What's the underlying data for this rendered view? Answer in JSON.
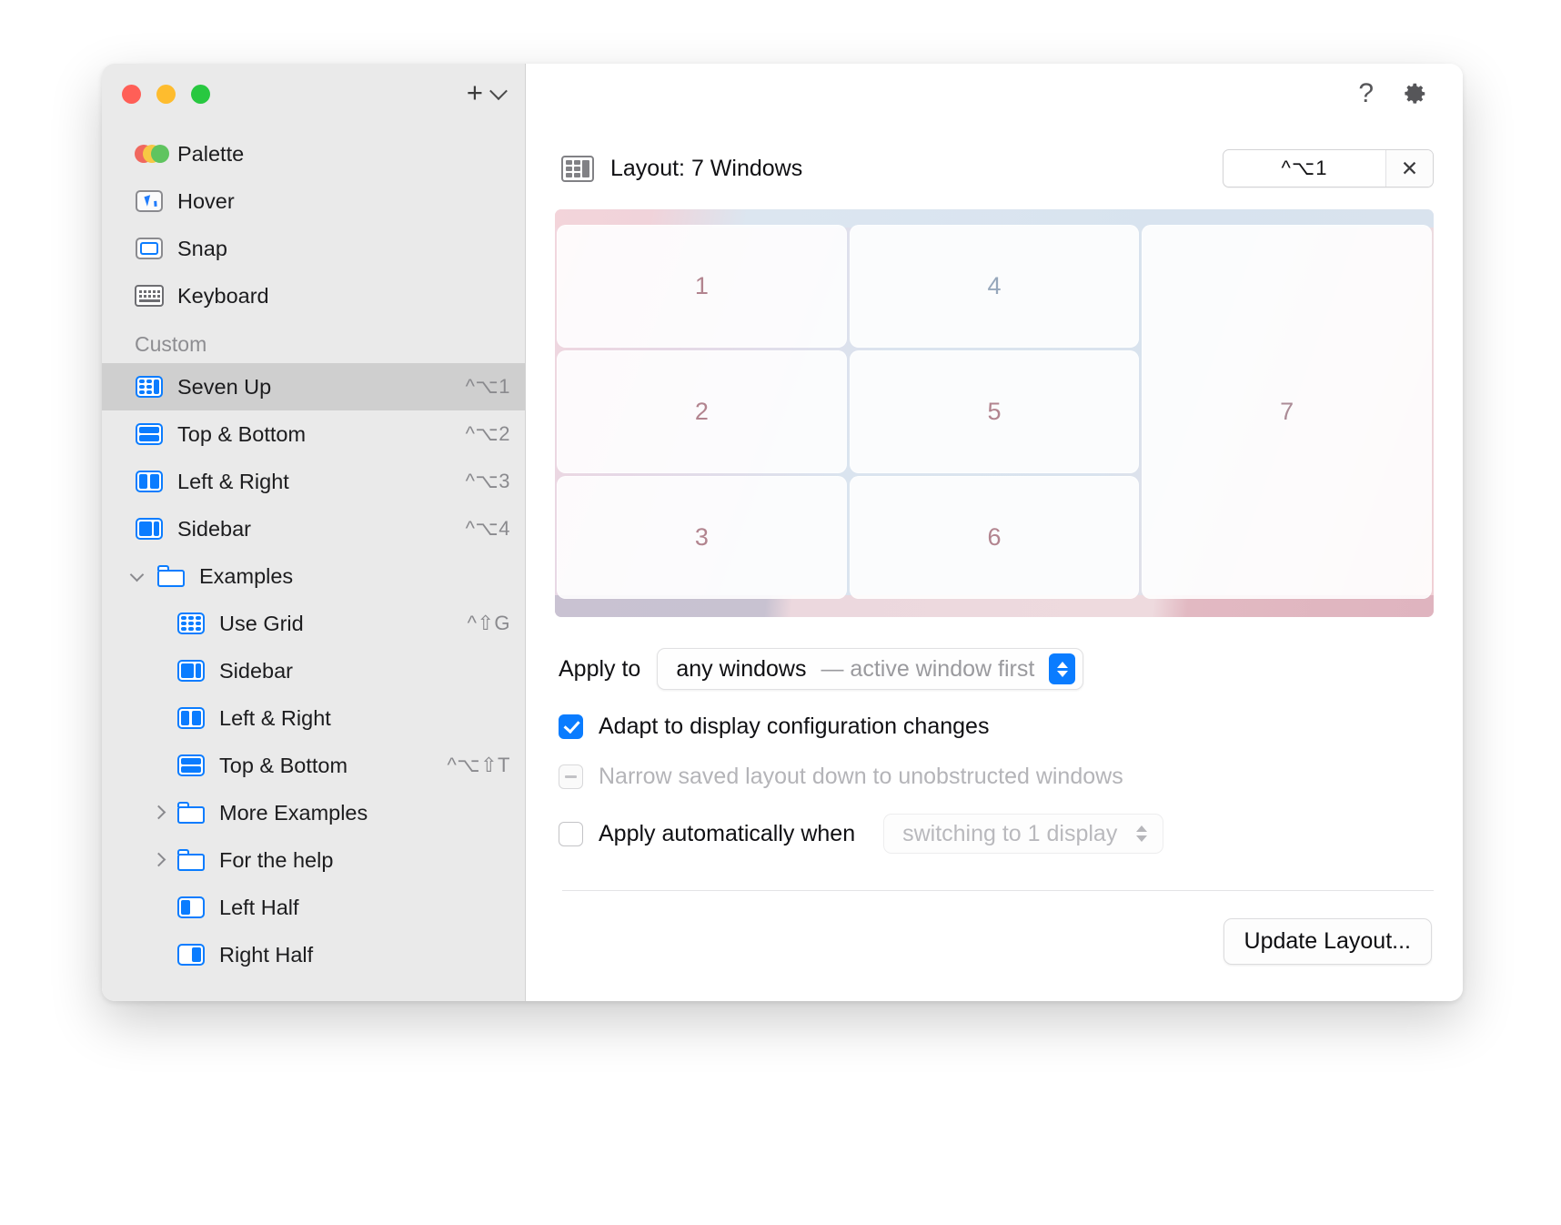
{
  "window": {
    "traffic_lights": [
      "close",
      "minimize",
      "zoom"
    ],
    "add_button": "+",
    "add_menu_chevron": "chevron-down"
  },
  "sidebar": {
    "modes": [
      {
        "label": "Palette",
        "icon": "palette-icon",
        "shortcut": ""
      },
      {
        "label": "Hover",
        "icon": "cursor-icon",
        "shortcut": ""
      },
      {
        "label": "Snap",
        "icon": "snap-icon",
        "shortcut": ""
      },
      {
        "label": "Keyboard",
        "icon": "keyboard-icon",
        "shortcut": ""
      }
    ],
    "custom_header": "Custom",
    "custom": [
      {
        "label": "Seven Up",
        "icon": "grid-7-icon",
        "shortcut": "^⌥1",
        "selected": true
      },
      {
        "label": "Top & Bottom",
        "icon": "top-bottom-icon",
        "shortcut": "^⌥2",
        "selected": false
      },
      {
        "label": "Left & Right",
        "icon": "left-right-icon",
        "shortcut": "^⌥3",
        "selected": false
      },
      {
        "label": "Sidebar",
        "icon": "sidebar-icon",
        "shortcut": "^⌥4",
        "selected": false
      }
    ],
    "examples_folder": {
      "label": "Examples",
      "expanded": true
    },
    "examples": [
      {
        "label": "Use Grid",
        "icon": "grid-icon",
        "shortcut": "^⇧G"
      },
      {
        "label": "Sidebar",
        "icon": "sidebar-icon",
        "shortcut": ""
      },
      {
        "label": "Left & Right",
        "icon": "left-right-icon",
        "shortcut": ""
      },
      {
        "label": "Top & Bottom",
        "icon": "top-bottom-icon",
        "shortcut": "^⌥⇧T"
      }
    ],
    "subfolders": [
      {
        "label": "More Examples",
        "expanded": false
      },
      {
        "label": "For the help",
        "expanded": false
      }
    ],
    "halves": [
      {
        "label": "Left Half",
        "icon": "left-half-icon",
        "shortcut": ""
      },
      {
        "label": "Right Half",
        "icon": "right-half-icon",
        "shortcut": ""
      }
    ]
  },
  "main": {
    "help_icon": "?",
    "gear_icon": "gear-icon",
    "layout_title": "Layout: 7 Windows",
    "layout_icon": "grid-7-icon",
    "shortcut_field": {
      "value": "^⌥1",
      "clear": "✕"
    },
    "preview": {
      "tiles": [
        "1",
        "2",
        "3",
        "4",
        "5",
        "6",
        "7"
      ]
    },
    "apply_to": {
      "label": "Apply to",
      "value_strong": "any windows",
      "value_dim": "— active window first"
    },
    "options": [
      {
        "label": "Adapt to display configuration changes",
        "state": "checked",
        "disabled": false
      },
      {
        "label": "Narrow saved layout down to unobstructed windows",
        "state": "mixed",
        "disabled": true
      }
    ],
    "auto_apply": {
      "label": "Apply automatically when",
      "state": "unchecked",
      "select_value": "switching to 1 display"
    },
    "update_button": "Update Layout..."
  },
  "colors": {
    "accent": "#0a7cff",
    "sidebar_bg": "#eaeaea",
    "selected_row": "#cfcfcf",
    "traffic_red": "#ff5f57",
    "traffic_yellow": "#febc2e",
    "traffic_green": "#28c840"
  }
}
